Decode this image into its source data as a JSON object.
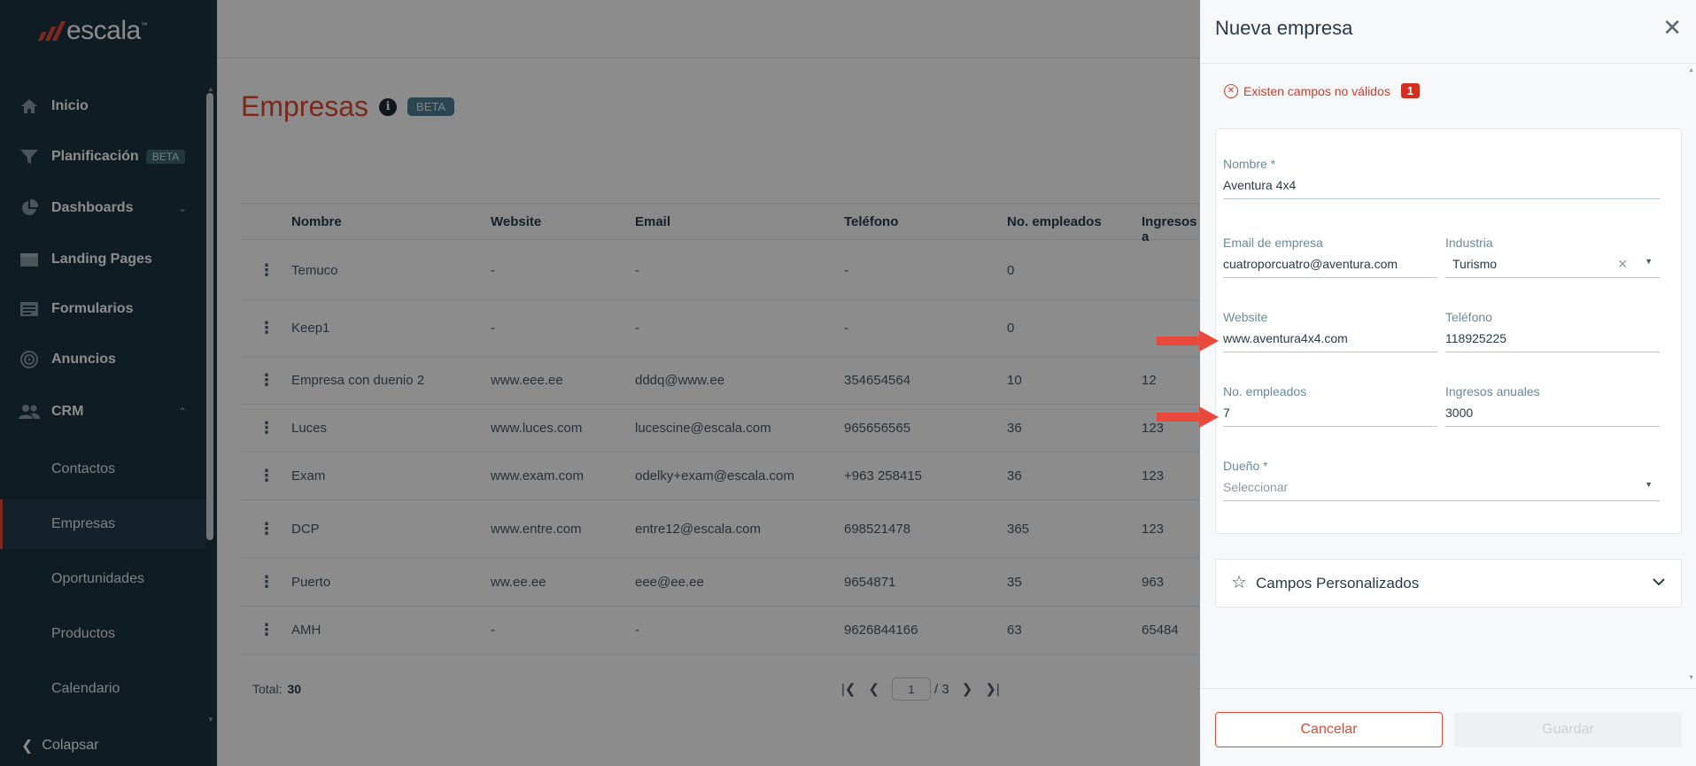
{
  "brand": {
    "name": "escala",
    "trademark": "™"
  },
  "sidebar": {
    "items": [
      {
        "label": "Inicio",
        "icon": "home-icon"
      },
      {
        "label": "Planificación",
        "icon": "funnel-icon",
        "badge": "BETA"
      },
      {
        "label": "Dashboards",
        "icon": "pie-chart-icon"
      },
      {
        "label": "Landing Pages",
        "icon": "folder-icon"
      },
      {
        "label": "Formularios",
        "icon": "form-icon"
      },
      {
        "label": "Anuncios",
        "icon": "target-icon"
      },
      {
        "label": "CRM",
        "icon": "users-icon"
      }
    ],
    "crm_children": [
      "Contactos",
      "Empresas",
      "Oportunidades",
      "Productos",
      "Calendario"
    ],
    "active": "Empresas",
    "collapse_label": "Colapsar"
  },
  "page": {
    "title": "Empresas",
    "beta": "BETA",
    "info_glyph": "i"
  },
  "table": {
    "columns": [
      "Nombre",
      "Website",
      "Email",
      "Teléfono",
      "No. empleados",
      "Ingresos a"
    ],
    "rows": [
      [
        "Temuco",
        "-",
        "-",
        "-",
        "0",
        ""
      ],
      [
        "Keep1",
        "-",
        "-",
        "-",
        "0",
        ""
      ],
      [
        "Empresa con duenio 2",
        "www.eee.ee",
        "dddq@www.ee",
        "354654564",
        "10",
        "12"
      ],
      [
        "Luces",
        "www.luces.com",
        "lucescine@escala.com",
        "965656565",
        "36",
        "123"
      ],
      [
        "Exam",
        "www.exam.com",
        "odelky+exam@escala.com",
        "+963 258415",
        "36",
        "123"
      ],
      [
        "DCP",
        "www.entre.com",
        "entre12@escala.com",
        "698521478",
        "365",
        "123"
      ],
      [
        "Puerto",
        "ww.ee.ee",
        "eee@ee.ee",
        "9654871",
        "35",
        "963"
      ],
      [
        "AMH",
        "-",
        "-",
        "9626844166",
        "63",
        "65484"
      ]
    ],
    "total_label": "Total:",
    "total_value": "30",
    "pagination": {
      "current": "1",
      "of": "/ 3"
    }
  },
  "drawer": {
    "title": "Nueva empresa",
    "error_text": "Existen campos no válidos",
    "error_count": "1",
    "fields": {
      "nombre": {
        "label": "Nombre *",
        "value": "Aventura 4x4"
      },
      "email": {
        "label": "Email de empresa",
        "value": "cuatroporcuatro@aventura.com"
      },
      "industria": {
        "label": "Industria",
        "value": "Turismo"
      },
      "website": {
        "label": "Website",
        "value": "www.aventura4x4.com"
      },
      "telefono": {
        "label": "Teléfono",
        "value": "118925225"
      },
      "empleados": {
        "label": "No. empleados",
        "value": "7"
      },
      "ingresos": {
        "label": "Ingresos anuales",
        "value": "3000"
      },
      "dueno": {
        "label": "Dueño *",
        "placeholder": "Seleccionar"
      }
    },
    "custom_fields_label": "Campos Personalizados",
    "cancel_label": "Cancelar",
    "save_label": "Guardar"
  },
  "colors": {
    "accent": "#e04a35",
    "sidebar": "#1e3341",
    "arrow": "#e8493a"
  }
}
